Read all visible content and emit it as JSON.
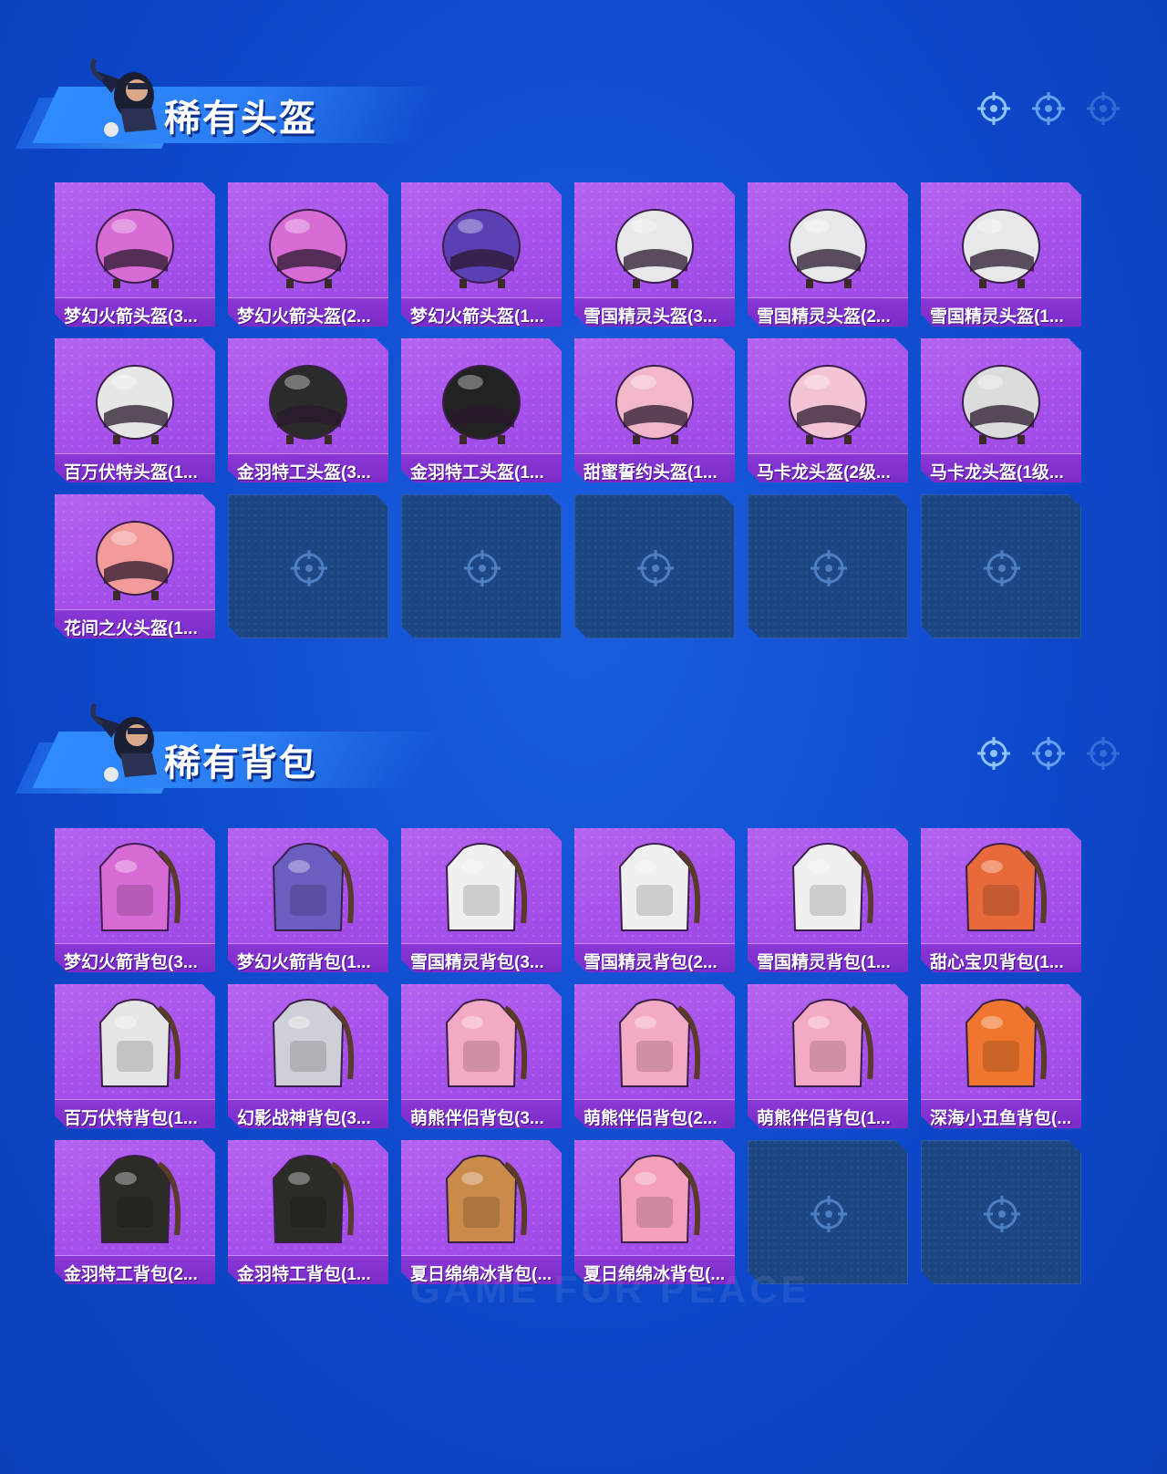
{
  "sections": [
    {
      "title": "稀有头盔",
      "items": [
        {
          "label": "梦幻火箭头盔(3...",
          "icon": "rocket-helmet-lv3",
          "color": "#d86bd6"
        },
        {
          "label": "梦幻火箭头盔(2...",
          "icon": "rocket-helmet-lv2",
          "color": "#d86bd6"
        },
        {
          "label": "梦幻火箭头盔(1...",
          "icon": "rocket-helmet-lv1",
          "color": "#5b3fb5"
        },
        {
          "label": "雪国精灵头盔(3...",
          "icon": "snow-spirit-helmet-lv3",
          "color": "#e8e8ea"
        },
        {
          "label": "雪国精灵头盔(2...",
          "icon": "snow-spirit-helmet-lv2",
          "color": "#e8e8ea"
        },
        {
          "label": "雪国精灵头盔(1...",
          "icon": "snow-spirit-helmet-lv1",
          "color": "#e8e8ea"
        },
        {
          "label": "百万伏特头盔(1...",
          "icon": "million-volt-helmet",
          "color": "#e6e6e6"
        },
        {
          "label": "金羽特工头盔(3...",
          "icon": "golden-feather-helmet-lv3",
          "color": "#2b2b2b"
        },
        {
          "label": "金羽特工头盔(1...",
          "icon": "golden-feather-helmet-lv1",
          "color": "#222222"
        },
        {
          "label": "甜蜜誓约头盔(1...",
          "icon": "sweet-vow-helmet",
          "color": "#f3b7cc"
        },
        {
          "label": "马卡龙头盔(2级...",
          "icon": "macaron-helmet-lv2",
          "color": "#f5c3d6"
        },
        {
          "label": "马卡龙头盔(1级...",
          "icon": "macaron-helmet-lv1",
          "color": "#dcdcdc"
        },
        {
          "label": "花间之火头盔(1...",
          "icon": "flower-fire-helmet",
          "color": "#f39a9a"
        }
      ],
      "empty_slots": 5
    },
    {
      "title": "稀有背包",
      "items": [
        {
          "label": "梦幻火箭背包(3...",
          "icon": "rocket-backpack-lv3",
          "color": "#d86bd6"
        },
        {
          "label": "梦幻火箭背包(1...",
          "icon": "rocket-backpack-lv1",
          "color": "#6a5fc0"
        },
        {
          "label": "雪国精灵背包(3...",
          "icon": "snow-spirit-backpack-lv3",
          "color": "#f0f0f0"
        },
        {
          "label": "雪国精灵背包(2...",
          "icon": "snow-spirit-backpack-lv2",
          "color": "#f0f0f0"
        },
        {
          "label": "雪国精灵背包(1...",
          "icon": "snow-spirit-backpack-lv1",
          "color": "#f0f0f0"
        },
        {
          "label": "甜心宝贝背包(1...",
          "icon": "sweetheart-backpack",
          "color": "#e86a3a"
        },
        {
          "label": "百万伏特背包(1...",
          "icon": "million-volt-backpack",
          "color": "#e6e6e6"
        },
        {
          "label": "幻影战神背包(3...",
          "icon": "phantom-war-god-backpack",
          "color": "#cfcfd8"
        },
        {
          "label": "萌熊伴侣背包(3...",
          "icon": "cute-bear-backpack-lv3",
          "color": "#f4a9c4"
        },
        {
          "label": "萌熊伴侣背包(2...",
          "icon": "cute-bear-backpack-lv2",
          "color": "#f4a9c4"
        },
        {
          "label": "萌熊伴侣背包(1...",
          "icon": "cute-bear-backpack-lv1",
          "color": "#f4a9c4"
        },
        {
          "label": "深海小丑鱼背包(...",
          "icon": "clownfish-backpack",
          "color": "#f0762f"
        },
        {
          "label": "金羽特工背包(2...",
          "icon": "golden-feather-backpack-lv2",
          "color": "#2c2c26"
        },
        {
          "label": "金羽特工背包(1...",
          "icon": "golden-feather-backpack-lv1",
          "color": "#2c2c26"
        },
        {
          "label": "夏日绵绵冰背包(...",
          "icon": "summer-icecream-backpack-a",
          "color": "#c98a4a"
        },
        {
          "label": "夏日绵绵冰背包(...",
          "icon": "summer-icecream-backpack-b",
          "color": "#f4a0b8"
        }
      ],
      "empty_slots": 2
    }
  ],
  "watermark": "GAME FOR PEACE"
}
